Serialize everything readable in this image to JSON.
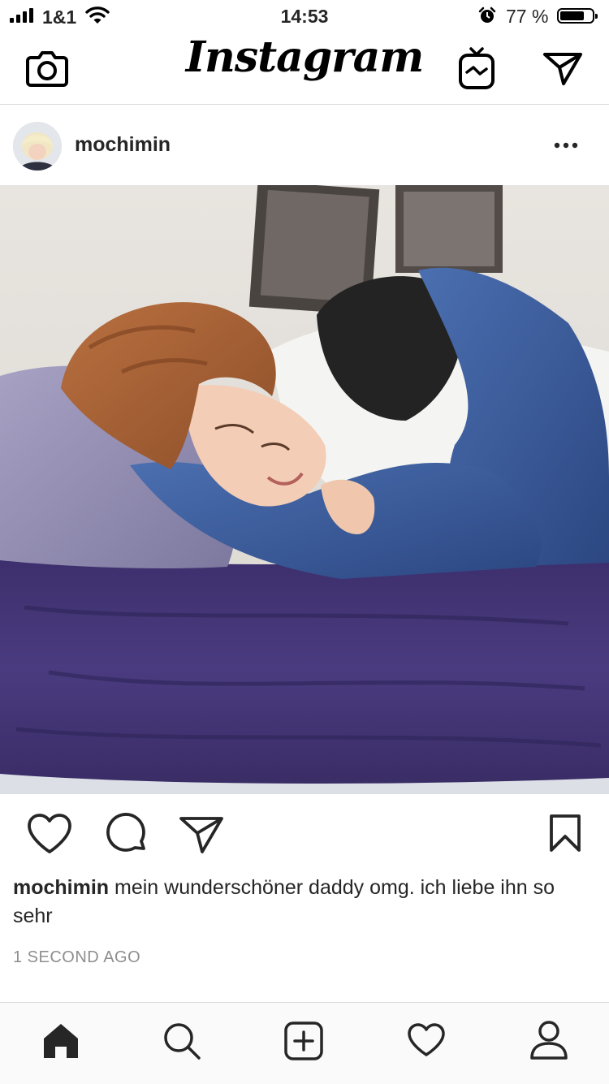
{
  "status_bar": {
    "carrier": "1&1",
    "time": "14:53",
    "battery_percent": "77 %",
    "battery_level": 0.77
  },
  "top_bar": {
    "logo_text": "Instagram",
    "icons": [
      "camera-icon",
      "igtv-icon",
      "direct-message-icon"
    ]
  },
  "post": {
    "username": "mochimin",
    "caption_username": "mochimin",
    "caption_text": " mein wunderschöner daddy omg. ich liebe ihn so sehr",
    "timestamp": "1 SECOND AGO",
    "actions": [
      "like-icon",
      "comment-icon",
      "share-icon",
      "bookmark-icon"
    ]
  },
  "tab_bar": {
    "items": [
      "home-icon",
      "search-icon",
      "new-post-icon",
      "activity-icon",
      "profile-icon"
    ],
    "active": "home-icon"
  }
}
